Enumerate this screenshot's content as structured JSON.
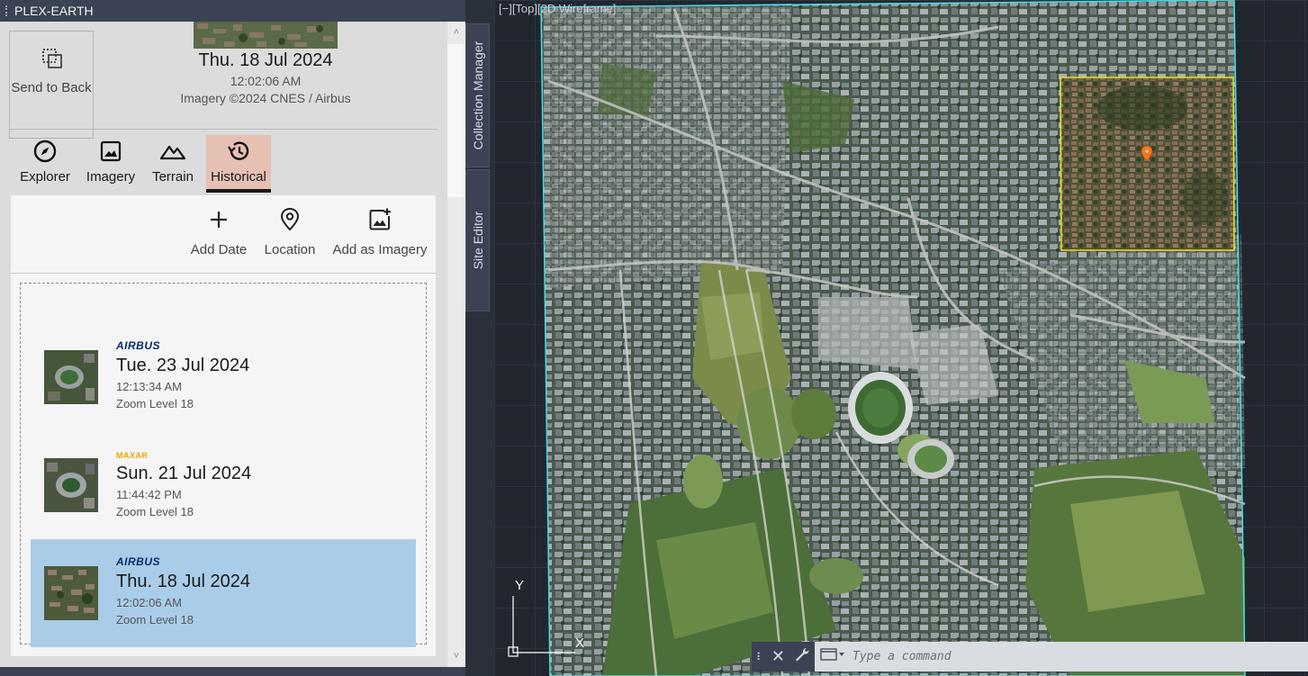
{
  "palette": {
    "title": "PLEX-EARTH",
    "send_to_back": "Send to Back",
    "current": {
      "date": "Thu. 18 Jul 2024",
      "time": "12:02:06 AM",
      "credit": "Imagery ©2024 CNES / Airbus"
    },
    "tabs": [
      {
        "label": "Explorer",
        "icon": "compass-icon"
      },
      {
        "label": "Imagery",
        "icon": "image-icon"
      },
      {
        "label": "Terrain",
        "icon": "mountains-icon"
      },
      {
        "label": "Historical",
        "icon": "history-icon",
        "active": true
      }
    ],
    "toolbar": {
      "add_date": "Add Date",
      "location": "Location",
      "add_as_imagery": "Add as Imagery"
    },
    "dates": [
      {
        "provider": "AIRBUS",
        "date": "Tue. 23 Jul 2024",
        "time": "12:13:34 AM",
        "zoom": "Zoom Level 18",
        "selected": false
      },
      {
        "provider": "MAXAR",
        "date": "Sun. 21 Jul 2024",
        "time": "11:44:42 PM",
        "zoom": "Zoom Level 18",
        "selected": false
      },
      {
        "provider": "AIRBUS",
        "date": "Thu. 18 Jul 2024",
        "time": "12:02:06 AM",
        "zoom": "Zoom Level 18",
        "selected": true
      }
    ]
  },
  "side_tabs": {
    "collection_manager": "Collection Manager",
    "site_editor": "Site Editor"
  },
  "viewport": {
    "label": "[−][Top][2D Wireframe]",
    "ucs_y": "Y",
    "ucs_x": "X"
  },
  "command": {
    "placeholder": "Type a command"
  },
  "colors": {
    "selected_row": "#a9cde8",
    "active_tab": "#e6c0b3",
    "imagery_boundary": "#40e0e8",
    "selection_box": "#e8e020",
    "pin": "#f07820"
  }
}
